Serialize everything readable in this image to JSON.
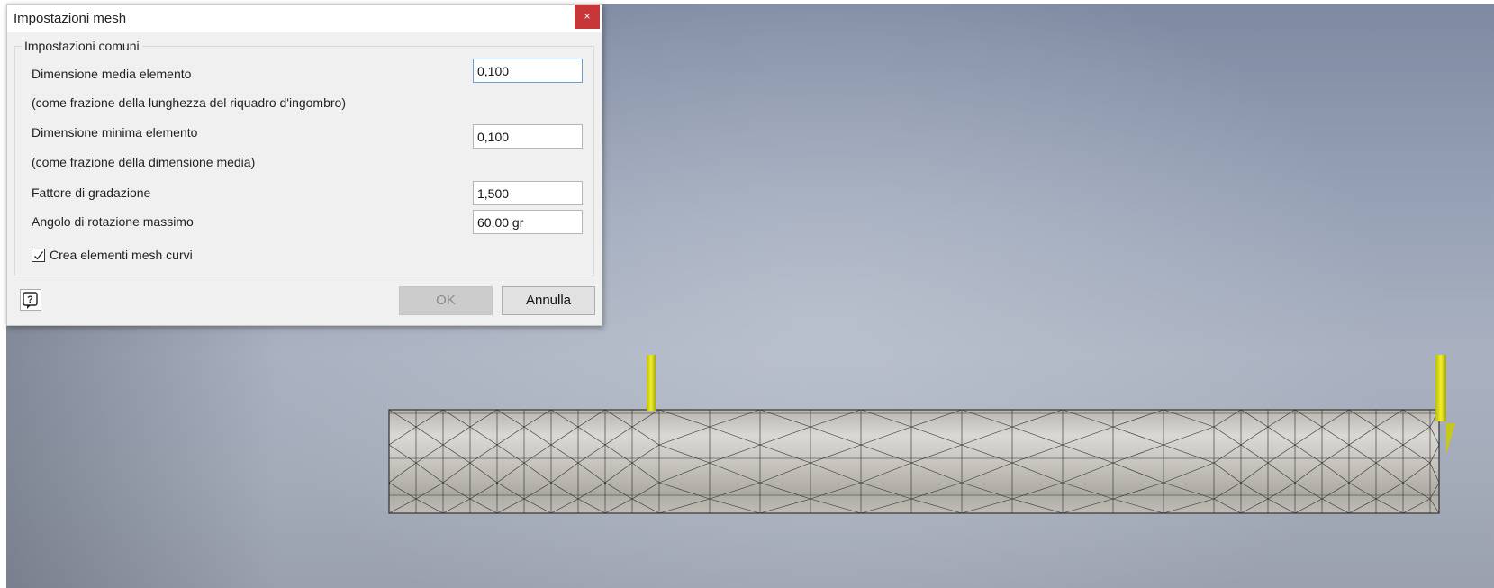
{
  "dialog": {
    "title": "Impostazioni mesh",
    "close_label": "×",
    "group_title": "Impostazioni comuni",
    "rows": [
      {
        "label": "Dimensione media elemento",
        "value": "0,100"
      },
      {
        "hint": "(come frazione della lunghezza del riquadro d'ingombro)"
      },
      {
        "label": "Dimensione minima elemento",
        "value": "0,100"
      },
      {
        "hint": "(come frazione della dimensione media)"
      },
      {
        "label": "Fattore di gradazione",
        "value": "1,500"
      },
      {
        "label": "Angolo di rotazione massimo",
        "value": "60,00 gr"
      }
    ],
    "checkbox": {
      "label": "Crea elementi mesh curvi",
      "checked": true
    },
    "ok_label": "OK",
    "cancel_label": "Annulla",
    "help_icon": "help-icon"
  },
  "viewport": {
    "model": "meshed beam",
    "load_arrow_color": "#d8d81a",
    "background_top": "#7f8aa2",
    "background_bottom": "#a4abb9"
  }
}
